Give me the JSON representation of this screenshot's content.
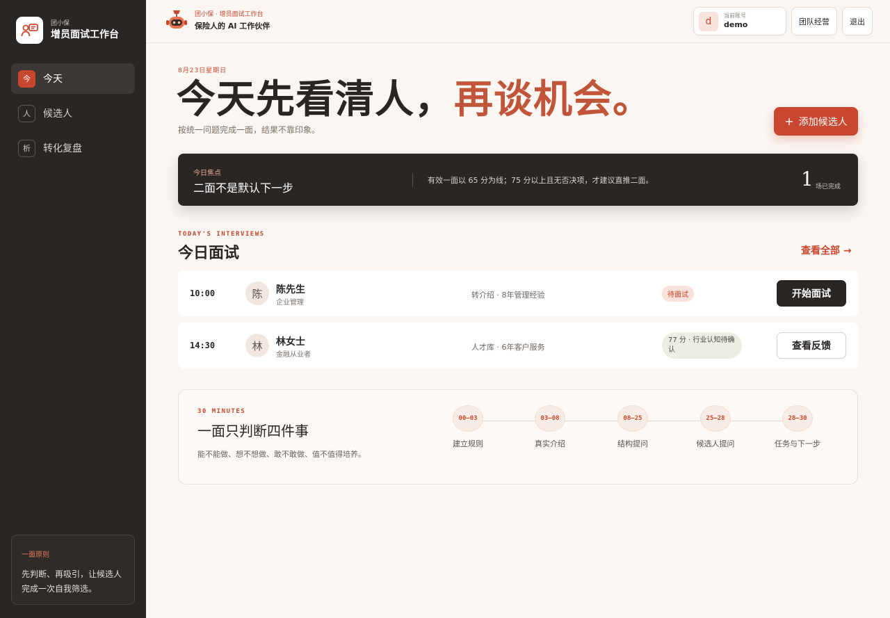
{
  "sidebar": {
    "brand_sub": "团小保",
    "brand_title": "增员面试工作台",
    "items": [
      {
        "icon": "今",
        "label": "今天"
      },
      {
        "icon": "人",
        "label": "候选人"
      },
      {
        "icon": "析",
        "label": "转化复盘"
      }
    ],
    "principle": {
      "title": "一面原则",
      "text": "先判断、再吸引，让候选人完成一次自我筛选。"
    }
  },
  "header": {
    "brand_sub": "团小保 · 增员面试工作台",
    "brand_title": "保险人的 AI 工作伙伴",
    "account": {
      "avatar_letter": "d",
      "label": "当前账号",
      "name": "demo"
    },
    "team_button": "团队经营",
    "logout_button": "退出"
  },
  "hero": {
    "date": "8月23日星期日",
    "headline_main": "今天先看清人，",
    "headline_accent": "再谈机会。",
    "subline": "按统一问题完成一面，结果不靠印象。",
    "add_button": "添加候选人"
  },
  "focus": {
    "label": "今日焦点",
    "title": "二面不是默认下一步",
    "desc": "有效一面以 65 分为线；75 分以上且无否决项，才建议直推二面。",
    "count": "1",
    "count_label": "场已完成"
  },
  "interviews": {
    "section_en": "TODAY'S INTERVIEWS",
    "section_title": "今日面试",
    "view_all": "查看全部 →",
    "rows": [
      {
        "time": "10:00",
        "avatar": "陈",
        "name": "陈先生",
        "role": "企业管理",
        "source": "转介绍 · 8年管理经验",
        "badge": "待面试",
        "action": "开始面试"
      },
      {
        "time": "14:30",
        "avatar": "林",
        "name": "林女士",
        "role": "金融从业者",
        "source": "人才库 · 6年客户服务",
        "badge": "77 分 · 行业认知待确认",
        "action": "查看反馈"
      }
    ]
  },
  "steps": {
    "section_en": "30 MINUTES",
    "title": "一面只判断四件事",
    "desc": "能不能做、想不想做、敢不敢做、值不值得培养。",
    "items": [
      {
        "range": "00–03",
        "label": "建立规则"
      },
      {
        "range": "03–08",
        "label": "真实介绍"
      },
      {
        "range": "08–25",
        "label": "结构提问"
      },
      {
        "range": "25–28",
        "label": "候选人提问"
      },
      {
        "range": "28–30",
        "label": "任务与下一步"
      }
    ]
  },
  "colors": {
    "accent": "#c9472e",
    "sidebar_bg": "#2a2624",
    "page_bg": "#fbf6f2"
  }
}
